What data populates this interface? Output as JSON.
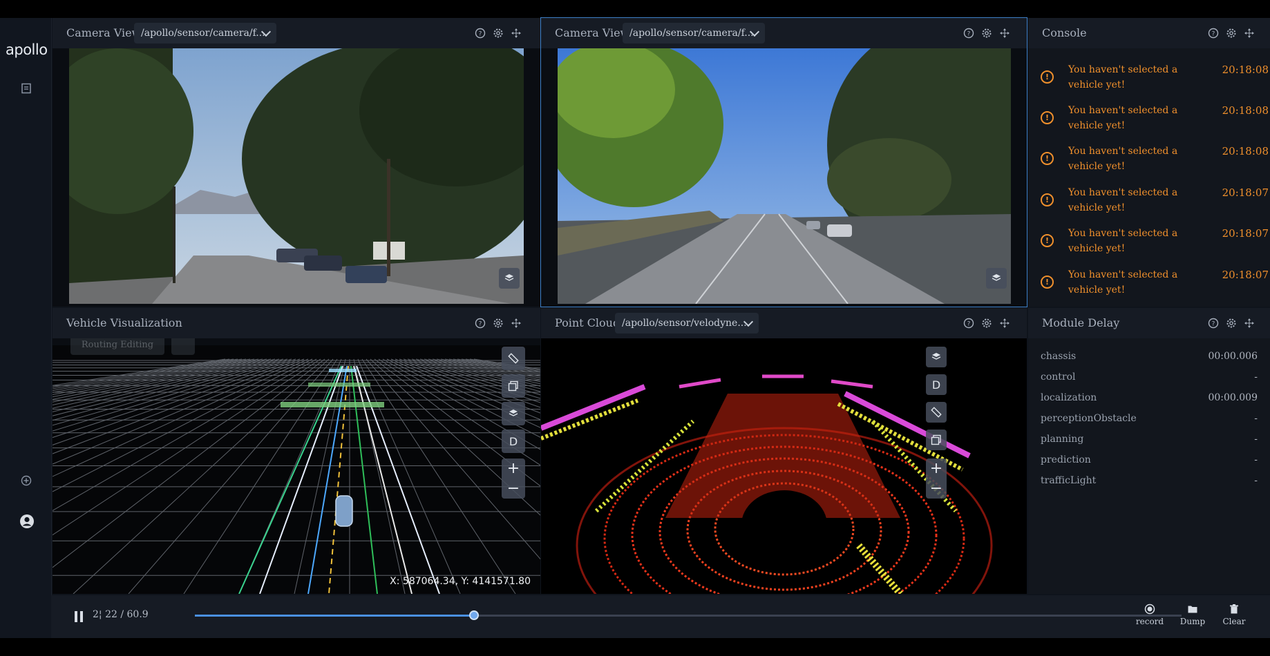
{
  "app": {
    "logo": "apollo"
  },
  "panels": {
    "camera1": {
      "title": "Camera View",
      "channel": "/apollo/sensor/camera/f..."
    },
    "camera2": {
      "title": "Camera View",
      "channel": "/apollo/sensor/camera/f..."
    },
    "console": {
      "title": "Console",
      "messages": [
        {
          "text": "You haven't selected a vehicle yet!",
          "time": "20:18:08"
        },
        {
          "text": "You haven't selected a vehicle yet!",
          "time": "20:18:08"
        },
        {
          "text": "You haven't selected a vehicle yet!",
          "time": "20:18:08"
        },
        {
          "text": "You haven't selected a vehicle yet!",
          "time": "20:18:07"
        },
        {
          "text": "You haven't selected a vehicle yet!",
          "time": "20:18:07"
        },
        {
          "text": "You haven't selected a vehicle yet!",
          "time": "20:18:07"
        }
      ]
    },
    "vehicle": {
      "title": "Vehicle Visualization",
      "coords": "X: 587064.34, Y: 4141571.80",
      "d_label": "D",
      "faded_label": "Routing Editing"
    },
    "pointcloud": {
      "title": "Point Cloud",
      "channel": "/apollo/sensor/velodyne...",
      "d_label": "D"
    },
    "module_delay": {
      "title": "Module Delay",
      "rows": [
        {
          "name": "chassis",
          "value": "00:00.006"
        },
        {
          "name": "control",
          "value": "-"
        },
        {
          "name": "localization",
          "value": "00:00.009"
        },
        {
          "name": "perceptionObstacle",
          "value": "-"
        },
        {
          "name": "planning",
          "value": "-"
        },
        {
          "name": "prediction",
          "value": "-"
        },
        {
          "name": "trafficLight",
          "value": "-"
        }
      ]
    }
  },
  "playback": {
    "time": "2¦ 22 / 60.9",
    "progress": 0.283,
    "record_label": "record",
    "dump_label": "Dump",
    "clear_label": "Clear"
  },
  "colors": {
    "accent": "#4a90e2",
    "warning": "#f0902c",
    "panel_header": "#161b24"
  }
}
